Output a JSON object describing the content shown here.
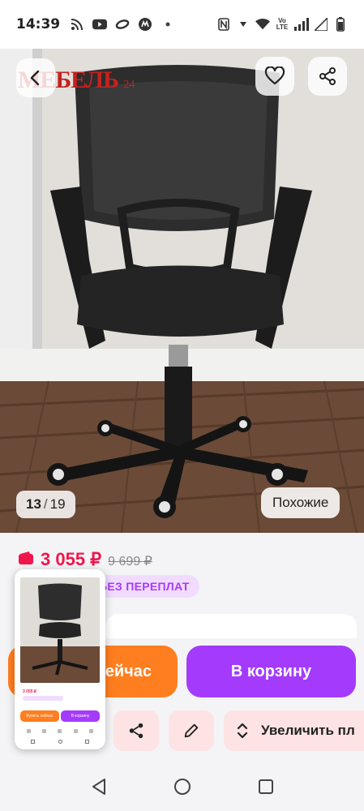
{
  "status_bar": {
    "time": "14:39",
    "left_icons": [
      "rss-icon",
      "youtube-icon",
      "ring-icon",
      "megamarket-icon",
      "dot-icon"
    ],
    "right_icons": [
      "nfc-icon",
      "vibrate-icon",
      "wifi-icon",
      "volte-icon",
      "signal-icon",
      "signal-icon-2",
      "battery-icon"
    ],
    "volte_text": "Vo\nLTE"
  },
  "hero": {
    "brand_text": "МЕБЕЛЬ",
    "brand_suffix": "24",
    "counter_current": "13",
    "counter_separator": "/",
    "counter_total": "19",
    "similar_label": "Похожие"
  },
  "price": {
    "current": "3 055 ₽",
    "old": "9 699 ₽",
    "promo": "БЕЗ ПЕРЕПЛАТ"
  },
  "buttons": {
    "buy_now": "Купить сейчас",
    "buy_now_visible": "ейчас",
    "add_to_cart": "В корзину",
    "zoom": "Увеличить пл"
  },
  "thumbnail": {
    "price": "3 055 ₽",
    "buy_now": "Купить сейчас",
    "add_to_cart": "В корзину"
  },
  "colors": {
    "price": "#f0164d",
    "buy_now": "#ff7e1f",
    "add_to_cart": "#a43bfc",
    "promo_bg": "#f1dcff",
    "action_bg": "#fde3e3"
  }
}
